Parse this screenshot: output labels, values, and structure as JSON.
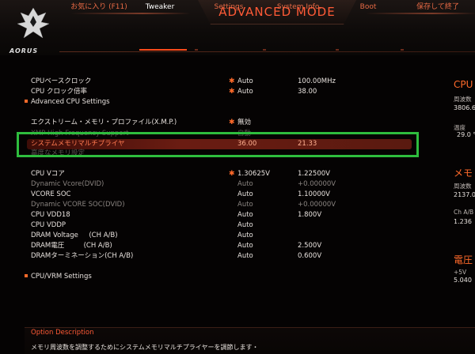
{
  "header": {
    "title": "ADVANCED MODE",
    "logo_text": "AORUS",
    "tabs": [
      {
        "label": "お気に入り (F11)"
      },
      {
        "label": "Tweaker"
      },
      {
        "label": "Settings"
      },
      {
        "label": "System Info."
      },
      {
        "label": "Boot"
      },
      {
        "label": "保存して終了"
      }
    ],
    "active_tab": "Tweaker"
  },
  "settings": {
    "cpu_base_clock": {
      "label": "CPUベースクロック",
      "value": "Auto",
      "value2": "100.00MHz"
    },
    "cpu_clock_ratio": {
      "label": "CPU クロック倍率",
      "value": "Auto",
      "value2": "38.00"
    },
    "advanced_cpu": {
      "label": "Advanced CPU Settings"
    },
    "xmp": {
      "label": "エクストリーム・メモリ・プロファイル(X.M.P.)",
      "value": "無効"
    },
    "xmp_high_freq": {
      "label": "XMP High Frequency Support",
      "value": "自動"
    },
    "mem_multiplier": {
      "label": "システムメモリマルチプライヤ",
      "value": "36.00",
      "value2": "21.33"
    },
    "advanced_memory": {
      "label": "高度なメモリ設定"
    },
    "cpu_vcore": {
      "label": "CPU Vコア",
      "value": "1.30625V",
      "value2": "1.22500V"
    },
    "dynamic_vcore": {
      "label": "Dynamic Vcore(DVID)",
      "value": "Auto",
      "value2": "+0.00000V"
    },
    "vcore_soc": {
      "label": "VCORE SOC",
      "value": "Auto",
      "value2": "1.10000V"
    },
    "dynamic_vcore_soc": {
      "label": "Dynamic VCORE SOC(DVID)",
      "value": "Auto",
      "value2": "+0.00000V"
    },
    "cpu_vdd18": {
      "label": "CPU VDD18",
      "value": "Auto",
      "value2": "1.800V"
    },
    "cpu_vddp": {
      "label": "CPU VDDP",
      "value": "Auto"
    },
    "dram_voltage": {
      "label": "DRAM Voltage     (CH A/B)",
      "value": "Auto"
    },
    "dram_denatsu": {
      "label": "DRAM電圧         (CH A/B)",
      "value": "Auto",
      "value2": "2.500V"
    },
    "dram_termination": {
      "label": "DRAMターミネーション(CH A/B)",
      "value": "Auto",
      "value2": "0.600V"
    },
    "cpu_vrm": {
      "label": "CPU/VRM Settings"
    }
  },
  "side_panel": {
    "cpu_title": "CPU",
    "freq_label": "周波数",
    "freq_value": "3806.6",
    "temp_label": "温度",
    "temp_value": "29.0 °",
    "mem_title": "メモ",
    "mem_freq_label": "周波数",
    "mem_freq_value": "2137.0",
    "ch_label": "Ch A/B",
    "ch_value": "1.236",
    "volt_title": "電圧",
    "plus5v_label": "+5V",
    "plus5v_value": "5.040"
  },
  "description": {
    "title": "Option Description",
    "text": "メモリ周波数を調整するためにシステムメモリマルチプライヤーを調節します・"
  },
  "colors": {
    "accent": "#ff5a36",
    "highlight": "#6a1c12",
    "annotation_box": "#2ebd3e"
  }
}
